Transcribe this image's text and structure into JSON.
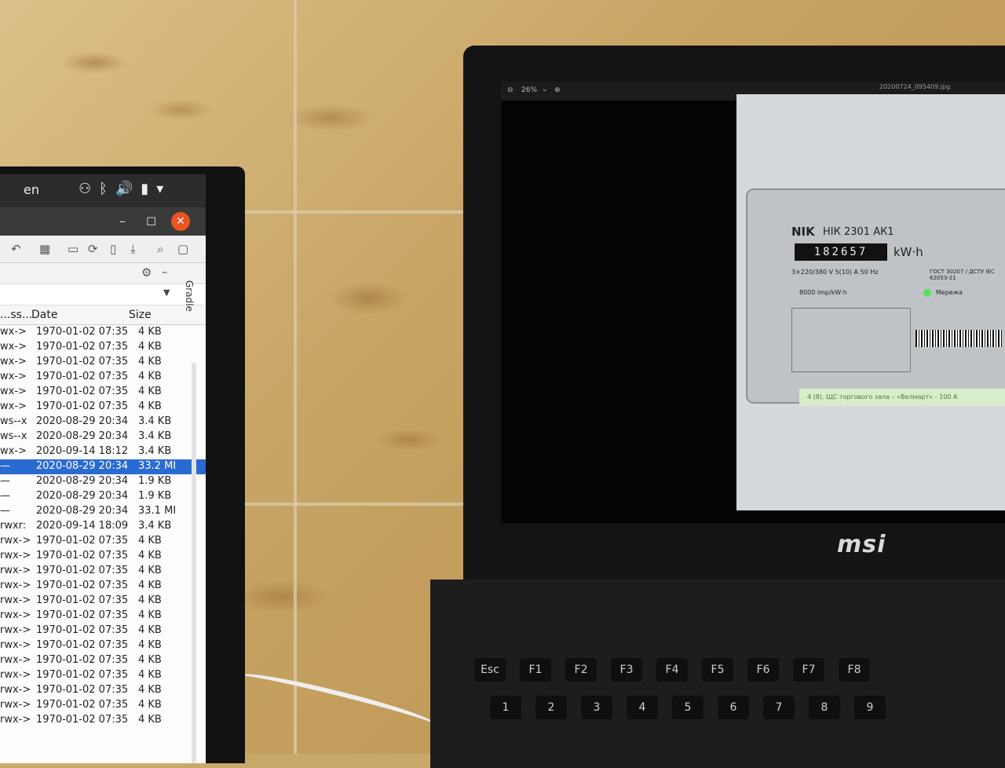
{
  "left_screen": {
    "panel": {
      "language": "en",
      "icons": [
        "network-icon",
        "bluetooth-icon",
        "volume-icon",
        "battery-icon",
        "menu-arrow-icon"
      ]
    },
    "window_controls": {
      "minimize": "–",
      "maximize": "◻",
      "close": "✕"
    },
    "side_tab": "Gradle",
    "columns": {
      "perm": "...ss...",
      "date": "Date",
      "size": "Size"
    },
    "rows": [
      {
        "perm": "wx->",
        "date": "1970-01-02 07:35",
        "size": "4 KB"
      },
      {
        "perm": "wx->",
        "date": "1970-01-02 07:35",
        "size": "4 KB"
      },
      {
        "perm": "wx->",
        "date": "1970-01-02 07:35",
        "size": "4 KB"
      },
      {
        "perm": "wx->",
        "date": "1970-01-02 07:35",
        "size": "4 KB"
      },
      {
        "perm": "wx->",
        "date": "1970-01-02 07:35",
        "size": "4 KB"
      },
      {
        "perm": "wx->",
        "date": "1970-01-02 07:35",
        "size": "4 KB"
      },
      {
        "perm": "ws--x",
        "date": "2020-08-29 20:34",
        "size": "3.4 KB"
      },
      {
        "perm": "ws--x",
        "date": "2020-08-29 20:34",
        "size": "3.4 KB"
      },
      {
        "perm": "wx->",
        "date": "2020-09-14 18:12",
        "size": "3.4 KB"
      },
      {
        "perm": "—",
        "date": "2020-08-29 20:34",
        "size": "33.2 MI",
        "selected": true
      },
      {
        "perm": "—",
        "date": "2020-08-29 20:34",
        "size": "1.9 KB"
      },
      {
        "perm": "—",
        "date": "2020-08-29 20:34",
        "size": "1.9 KB"
      },
      {
        "perm": "—",
        "date": "2020-08-29 20:34",
        "size": "33.1 MI"
      },
      {
        "perm": "rwxr:",
        "date": "2020-09-14 18:09",
        "size": "3.4 KB"
      },
      {
        "perm": "rwx->",
        "date": "1970-01-02 07:35",
        "size": "4 KB"
      },
      {
        "perm": "rwx->",
        "date": "1970-01-02 07:35",
        "size": "4 KB"
      },
      {
        "perm": "rwx->",
        "date": "1970-01-02 07:35",
        "size": "4 KB"
      },
      {
        "perm": "rwx->",
        "date": "1970-01-02 07:35",
        "size": "4 KB"
      },
      {
        "perm": "rwx->",
        "date": "1970-01-02 07:35",
        "size": "4 KB"
      },
      {
        "perm": "rwx->",
        "date": "1970-01-02 07:35",
        "size": "4 KB"
      },
      {
        "perm": "rwx->",
        "date": "1970-01-02 07:35",
        "size": "4 KB"
      },
      {
        "perm": "rwx->",
        "date": "1970-01-02 07:35",
        "size": "4 KB"
      },
      {
        "perm": "rwx->",
        "date": "1970-01-02 07:35",
        "size": "4 KB"
      },
      {
        "perm": "rwx->",
        "date": "1970-01-02 07:35",
        "size": "4 KB"
      },
      {
        "perm": "rwx->",
        "date": "1970-01-02 07:35",
        "size": "4 KB"
      },
      {
        "perm": "rwx->",
        "date": "1970-01-02 07:35",
        "size": "4 KB"
      },
      {
        "perm": "rwx->",
        "date": "1970-01-02 07:35",
        "size": "4 KB"
      }
    ]
  },
  "laptop": {
    "viewer": {
      "zoom": "26%",
      "filename": "20200724_095409.jpg"
    },
    "meter": {
      "brand": "NIK",
      "model": "НІК 2301 АК1",
      "reading": "182657",
      "unit": "kW·h",
      "spec": "3×220/380 V  5(10) A  50 Hz",
      "standard": "ГОСТ 30207 / ДСТУ IEC 62053-21",
      "impulses": "8000 imp/kW·h",
      "network": "Мережа",
      "label": "4 (8). ЩС торгового зала – «Велмарт» - 100 А"
    },
    "brand_logo": "msi",
    "keys": [
      "Esc",
      "F1",
      "F2",
      "F3",
      "F4",
      "F5",
      "F6",
      "F7",
      "F8",
      "1",
      "2",
      "3",
      "4",
      "5",
      "6",
      "7",
      "8",
      "9"
    ]
  }
}
